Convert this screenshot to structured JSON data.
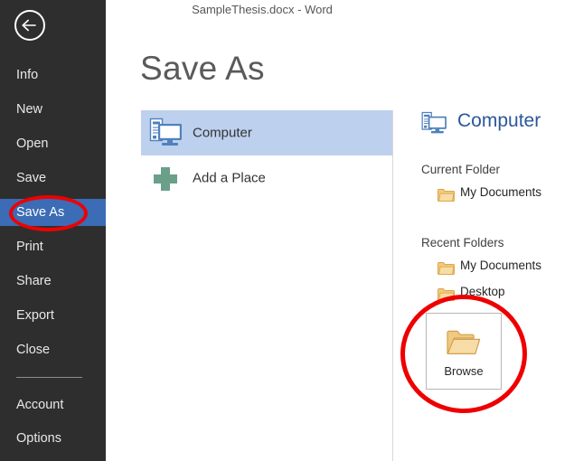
{
  "window": {
    "title": "SampleThesis.docx - Word",
    "back_icon": "back-arrow-icon"
  },
  "sidebar": {
    "background_color": "#2e2e2e",
    "selected_color": "#3b6cb5",
    "items": [
      {
        "label": "Info",
        "selected": false
      },
      {
        "label": "New",
        "selected": false
      },
      {
        "label": "Open",
        "selected": false
      },
      {
        "label": "Save",
        "selected": false
      },
      {
        "label": "Save As",
        "selected": true
      },
      {
        "label": "Print",
        "selected": false
      },
      {
        "label": "Share",
        "selected": false
      },
      {
        "label": "Export",
        "selected": false
      },
      {
        "label": "Close",
        "selected": false
      },
      {
        "label": "Account",
        "selected": false
      },
      {
        "label": "Options",
        "selected": false
      }
    ]
  },
  "main": {
    "page_title": "Save As",
    "places": [
      {
        "label": "Computer",
        "icon": "computer-icon",
        "selected": true
      },
      {
        "label": "Add a Place",
        "icon": "plus-icon",
        "selected": false
      }
    ],
    "places_highlight_color": "#bdd0ee"
  },
  "detail": {
    "header_label": "Computer",
    "header_icon": "computer-icon",
    "header_color": "#2b579a",
    "current_folder_title": "Current Folder",
    "current_folders": [
      {
        "label": "My Documents",
        "icon": "folder-icon"
      }
    ],
    "recent_folders_title": "Recent Folders",
    "recent_folders": [
      {
        "label": "My Documents",
        "icon": "folder-icon"
      },
      {
        "label": "Desktop",
        "icon": "folder-icon"
      }
    ],
    "browse": {
      "label": "Browse",
      "icon": "open-folder-icon"
    }
  },
  "annotations": {
    "color": "#ee0000",
    "shapes": [
      {
        "name": "ellipse-around-save-as",
        "target": "Save As"
      },
      {
        "name": "circle-around-browse",
        "target": "Browse"
      }
    ]
  }
}
